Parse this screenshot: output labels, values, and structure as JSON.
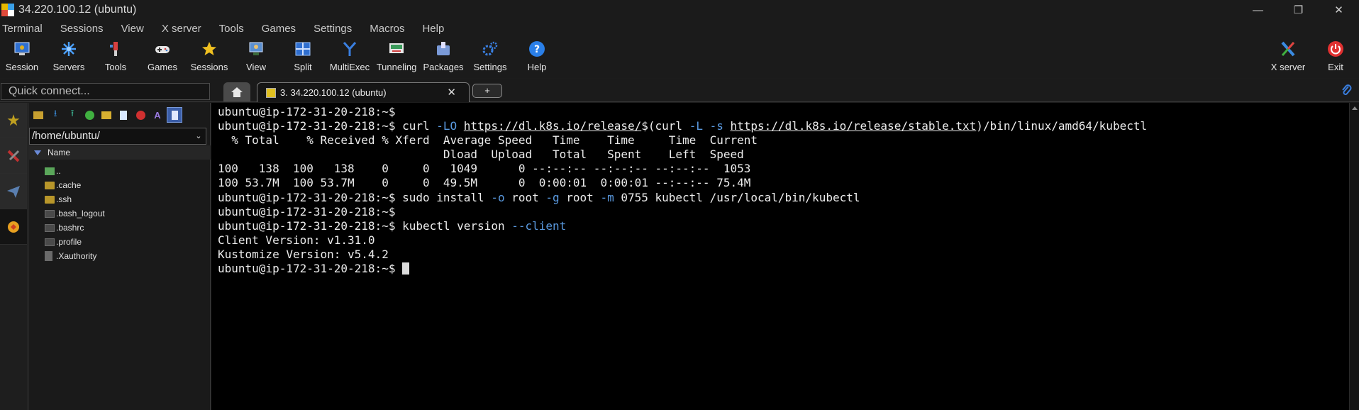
{
  "window": {
    "title": "34.220.100.12 (ubuntu)",
    "controls": [
      "—",
      "❐",
      "✕"
    ]
  },
  "menu": [
    "Terminal",
    "Sessions",
    "View",
    "X server",
    "Tools",
    "Games",
    "Settings",
    "Macros",
    "Help"
  ],
  "toolbar": {
    "left": [
      {
        "label": "Session",
        "icon": "session-icon"
      },
      {
        "label": "Servers",
        "icon": "servers-icon"
      },
      {
        "label": "Tools",
        "icon": "tools-icon"
      },
      {
        "label": "Games",
        "icon": "games-icon"
      },
      {
        "label": "Sessions",
        "icon": "star-icon"
      },
      {
        "label": "View",
        "icon": "view-icon"
      },
      {
        "label": "Split",
        "icon": "split-icon"
      },
      {
        "label": "MultiExec",
        "icon": "multiexec-icon"
      },
      {
        "label": "Tunneling",
        "icon": "tunneling-icon"
      },
      {
        "label": "Packages",
        "icon": "packages-icon"
      },
      {
        "label": "Settings",
        "icon": "settings-icon"
      },
      {
        "label": "Help",
        "icon": "help-icon"
      }
    ],
    "right": [
      {
        "label": "X server",
        "icon": "x-server-icon"
      },
      {
        "label": "Exit",
        "icon": "power-icon"
      }
    ]
  },
  "quick_connect": {
    "placeholder": "Quick connect..."
  },
  "tabs": {
    "session_tab_label": "3. 34.220.100.12 (ubuntu)",
    "close_glyph": "✕",
    "new_tab_glyph": "+"
  },
  "sidebar": {
    "path": "/home/ubuntu/",
    "column_name": "Name",
    "files": [
      {
        "name": "..",
        "type": "up"
      },
      {
        "name": ".cache",
        "type": "folder"
      },
      {
        "name": ".ssh",
        "type": "folder"
      },
      {
        "name": ".bash_logout",
        "type": "doc"
      },
      {
        "name": ".bashrc",
        "type": "doc"
      },
      {
        "name": ".profile",
        "type": "doc"
      },
      {
        "name": ".Xauthority",
        "type": "page"
      }
    ]
  },
  "terminal": {
    "prompt": "ubuntu@ip-172-31-20-218:~$",
    "lines": [
      {
        "prompt": "ubuntu@ip-172-31-20-218:~$",
        "cmd": ""
      },
      {
        "prompt": "ubuntu@ip-172-31-20-218:~$",
        "parts": [
          {
            "t": " curl "
          },
          {
            "t": "-LO",
            "c": "opt"
          },
          {
            "t": " "
          },
          {
            "t": "https://dl.k8s.io/release/",
            "c": "u"
          },
          {
            "t": "$(curl "
          },
          {
            "t": "-L",
            "c": "opt"
          },
          {
            "t": " "
          },
          {
            "t": "-s",
            "c": "opt"
          },
          {
            "t": " "
          },
          {
            "t": "https://dl.k8s.io/release/stable.txt",
            "c": "u"
          },
          {
            "t": ")/bin/linux/amd64/kubectl"
          }
        ]
      },
      {
        "text": "  % Total    % Received % Xferd  Average Speed   Time    Time     Time  Current"
      },
      {
        "text": "                                 Dload  Upload   Total   Spent    Left  Speed"
      },
      {
        "text": "100   138  100   138    0     0   1049      0 --:--:-- --:--:-- --:--:--  1053"
      },
      {
        "text": "100 53.7M  100 53.7M    0     0  49.5M      0  0:00:01  0:00:01 --:--:-- 75.4M"
      },
      {
        "prompt": "ubuntu@ip-172-31-20-218:~$",
        "parts": [
          {
            "t": " sudo install "
          },
          {
            "t": "-o",
            "c": "opt"
          },
          {
            "t": " root "
          },
          {
            "t": "-g",
            "c": "opt"
          },
          {
            "t": " root "
          },
          {
            "t": "-m",
            "c": "opt"
          },
          {
            "t": " 0755 kubectl /usr/local/bin/kubectl"
          }
        ]
      },
      {
        "prompt": "ubuntu@ip-172-31-20-218:~$",
        "cmd": ""
      },
      {
        "prompt": "ubuntu@ip-172-31-20-218:~$",
        "parts": [
          {
            "t": " kubectl version "
          },
          {
            "t": "--client",
            "c": "opt"
          }
        ]
      },
      {
        "text": "Client Version: v1.31.0"
      },
      {
        "text": "Kustomize Version: v5.4.2"
      },
      {
        "prompt": "ubuntu@ip-172-31-20-218:~$",
        "cursor": true
      }
    ]
  },
  "colors": {
    "background": "#1c1c1c",
    "terminal_bg": "#000000",
    "option_blue": "#5a9ae0",
    "accent_blue": "#3b5ea8"
  }
}
